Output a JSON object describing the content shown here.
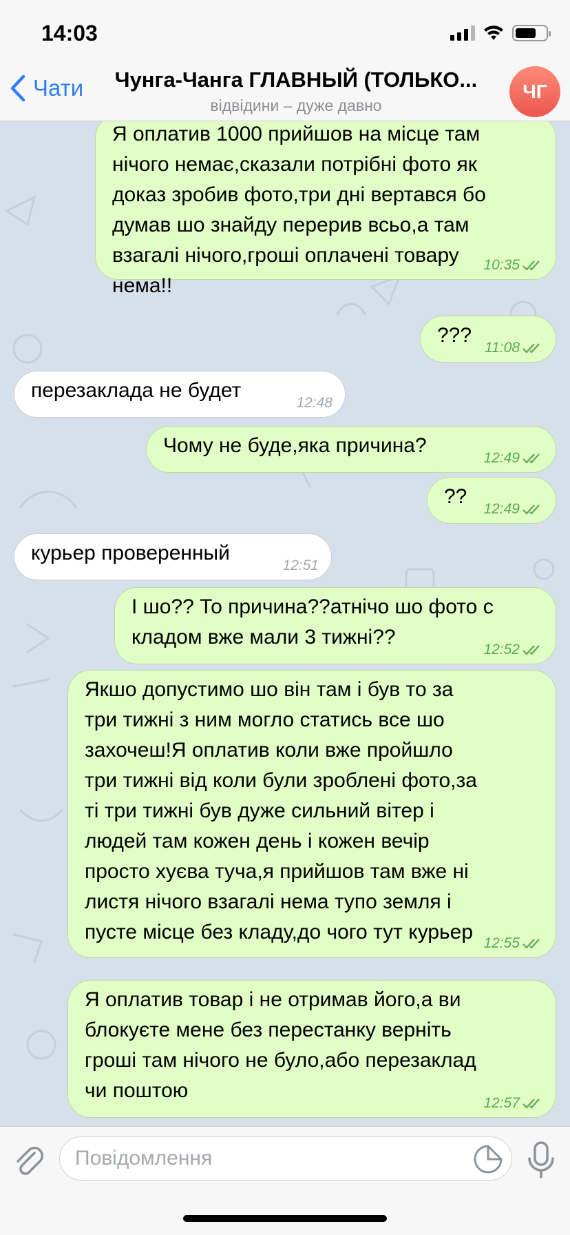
{
  "status_bar": {
    "time": "14:03"
  },
  "header": {
    "back_label": "Чати",
    "title": "Чунга-Чанга ГЛАВНЫЙ (ТОЛЬКО...",
    "subtitle": "відвідини – дуже давно",
    "avatar_initials": "ЧГ"
  },
  "messages": [
    {
      "dir": "out",
      "text": "Я оплатив 1000 прийшов на місце там\nнічого немає,сказали потрібні фото як\nдоказ зробив фото,три дні вертався бо\nдумав шо знайду перерив всьо,а там\nвзагалі нічого,гроші оплачені товару\nнема!!",
      "time": "10:35"
    },
    {
      "dir": "out",
      "text": "???",
      "time": "11:08"
    },
    {
      "dir": "in",
      "text": "перезаклада не будет",
      "time": "12:48"
    },
    {
      "dir": "out",
      "text": "Чому не буде,яка причина?",
      "time": "12:49"
    },
    {
      "dir": "out",
      "text": "??",
      "time": "12:49"
    },
    {
      "dir": "in",
      "text": "курьер проверенный",
      "time": "12:51"
    },
    {
      "dir": "out",
      "text": "І шо?? То причина??атнічо шо фото с\nкладом вже мали 3 тижні??",
      "time": "12:52"
    },
    {
      "dir": "out",
      "text": "Якшо допустимо шо він там і був то за\nтри тижні з ним могло статись все шо\nзахочеш!Я оплатив коли вже пройшло\nтри тижні від коли були зроблені фото,за\nті три тижні був дуже сильний вітер і\nлюдей там кожен день і кожен вечір\nпросто хуєва туча,я прийшов там вже ні\nлистя нічого взагалі нема тупо земля і\nпусте місце без кладу,до чого тут курьер",
      "time": "12:55"
    },
    {
      "dir": "out",
      "text": "Я оплатив товар і не отримав його,а ви\nблокуєте мене без перестанку верніть\nгроші там нічого не було,або перезаклад\nчи поштою",
      "time": "12:57"
    }
  ],
  "composer": {
    "placeholder": "Повідомлення"
  },
  "colors": {
    "outgoing_bubble": "#e1fec6",
    "incoming_bubble": "#ffffff",
    "accent": "#2d7ef7",
    "timestamp_out": "#5ca853",
    "avatar": "#e9584c"
  },
  "icons": [
    "back-chevron-icon",
    "attach-paperclip-icon",
    "sticker-icon",
    "microphone-icon",
    "double-check-icon"
  ]
}
